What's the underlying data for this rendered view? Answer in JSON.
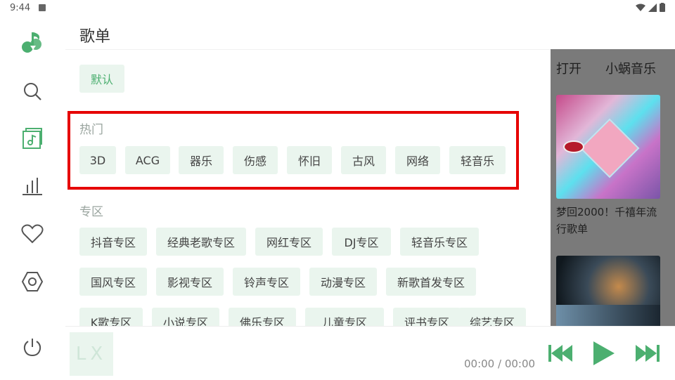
{
  "status": {
    "time": "9:44"
  },
  "page": {
    "title": "歌单"
  },
  "default_tag": "默认",
  "hot": {
    "label": "热门",
    "tags": [
      "3D",
      "ACG",
      "器乐",
      "伤感",
      "怀旧",
      "古风",
      "网络",
      "轻音乐"
    ]
  },
  "zone": {
    "label": "专区",
    "rows": [
      [
        "抖音专区",
        "经典老歌专区",
        "网红专区",
        "DJ专区",
        "轻音乐专区"
      ],
      [
        "国风专区",
        "影视专区",
        "铃声专区",
        "动漫专区",
        "新歌首发专区"
      ],
      [
        "K歌专区",
        "小说专区",
        "佛乐专区",
        "儿童专区",
        "评书专区",
        "综艺专区"
      ]
    ]
  },
  "overlay": {
    "tabs": [
      "打开",
      "小蜗音乐"
    ],
    "card1_title": "梦回2000！千禧年流行歌单"
  },
  "player": {
    "cover_text": "LX",
    "time": "00:00 / 00:00"
  },
  "colors": {
    "accent": "#4caf70",
    "tag_bg": "#eaf5ee",
    "highlight": "#e60000"
  }
}
